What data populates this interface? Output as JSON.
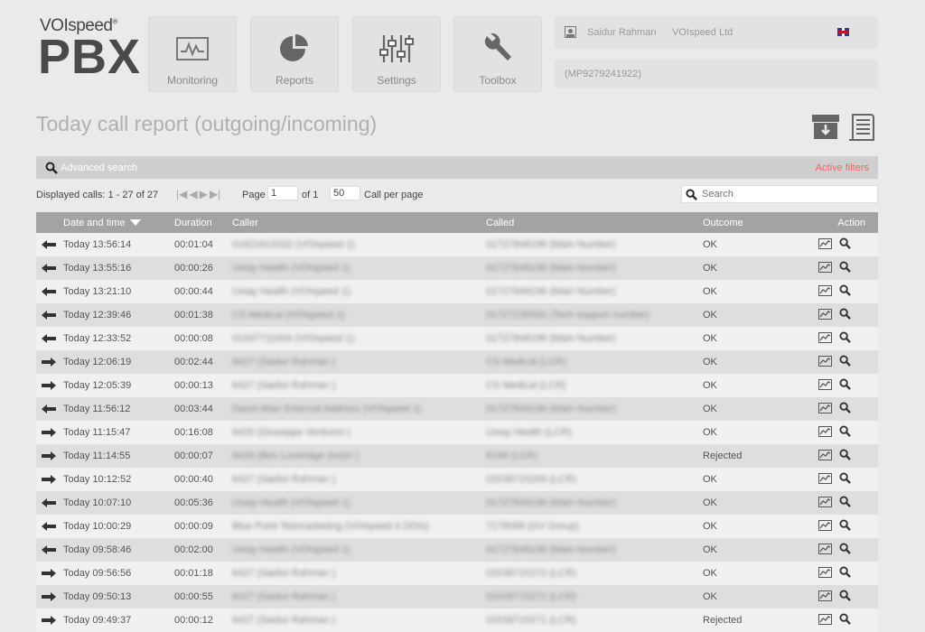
{
  "logo": {
    "brand": "VOIspeed",
    "mark": "®",
    "product": "PBX"
  },
  "nav": [
    {
      "label": "Monitoring",
      "icon": "monitoring-icon"
    },
    {
      "label": "Reports",
      "icon": "pie-chart-icon"
    },
    {
      "label": "Settings",
      "icon": "sliders-icon"
    },
    {
      "label": "Toolbox",
      "icon": "wrench-icon"
    }
  ],
  "user": {
    "name": "Saidur Rahman",
    "company": "VOIspeed Ltd",
    "account": "(MP9279241922)",
    "language_flag": "uk-flag-icon"
  },
  "page_title": "Today call report (outgoing/incoming)",
  "toolbar": {
    "advanced_search": "Advanced search",
    "active_filters": "Active filters"
  },
  "pager": {
    "displayed": "Displayed calls: 1 - 27 of 27",
    "page_label": "Page",
    "page_value": "1",
    "of_label": "of 1",
    "per_page_value": "50",
    "per_page_label": "Call per page",
    "search_placeholder": "Search"
  },
  "table": {
    "headers": {
      "date": "Date and time",
      "duration": "Duration",
      "caller": "Caller",
      "called": "Called",
      "outcome": "Outcome",
      "action": "Action"
    },
    "rows": [
      {
        "dir": "in",
        "date": "Today 13:56:14",
        "duration": "00:01:04",
        "caller": "01621613332 (VOIspeed 1)",
        "called": "01727848196 (Main Number)",
        "outcome": "OK"
      },
      {
        "dir": "in",
        "date": "Today 13:55:16",
        "duration": "00:00:26",
        "caller": "Uway Health (VOIspeed 1)",
        "called": "01727848196 (Main Number)",
        "outcome": "OK"
      },
      {
        "dir": "in",
        "date": "Today 13:21:10",
        "duration": "00:00:44",
        "caller": "Uway Health (VOIspeed 1)",
        "called": "01727848196 (Main Number)",
        "outcome": "OK"
      },
      {
        "dir": "in",
        "date": "Today 12:39:46",
        "duration": "00:01:38",
        "caller": "CS Medical (VOIspeed 1)",
        "called": "01727238592 (Tech support number)",
        "outcome": "OK"
      },
      {
        "dir": "in",
        "date": "Today 12:33:52",
        "duration": "00:00:08",
        "caller": "01937711004 (VOIspeed 1)",
        "called": "01727848196 (Main Number)",
        "outcome": "OK"
      },
      {
        "dir": "out",
        "date": "Today 12:06:19",
        "duration": "00:02:44",
        "caller": "6427 (Saidur Rahman )",
        "called": "CS Medical (LCR)",
        "outcome": "OK"
      },
      {
        "dir": "out",
        "date": "Today 12:05:39",
        "duration": "00:00:13",
        "caller": "6427 (Saidur Rahman )",
        "called": "CS Medical (LCR)",
        "outcome": "OK"
      },
      {
        "dir": "in",
        "date": "Today 11:56:12",
        "duration": "00:03:44",
        "caller": "David Allan External Address (VOIspeed 1)",
        "called": "01727848196 (Main Number)",
        "outcome": "OK"
      },
      {
        "dir": "out",
        "date": "Today 11:15:47",
        "duration": "00:16:08",
        "caller": "6420 (Giuseppe Venturini )",
        "called": "Uway Health (LCR)",
        "outcome": "OK"
      },
      {
        "dir": "out",
        "date": "Today 11:14:55",
        "duration": "00:00:07",
        "caller": "6428 (Ben Loveridge (ext)n )",
        "called": "6248 (LCR)",
        "outcome": "Rejected"
      },
      {
        "dir": "out",
        "date": "Today 10:12:52",
        "duration": "00:00:40",
        "caller": "6427 (Saidur Rahman )",
        "called": "02038715269 (LCR)",
        "outcome": "OK"
      },
      {
        "dir": "in",
        "date": "Today 10:07:10",
        "duration": "00:05:36",
        "caller": "Uway Health (VOIspeed 1)",
        "called": "01727848196 (Main Number)",
        "outcome": "OK"
      },
      {
        "dir": "in",
        "date": "Today 10:00:29",
        "duration": "00:00:09",
        "caller": "Blue Point Telemarketing (VOIspeed 4 DDIs)",
        "called": "7178098 (GV Group)",
        "outcome": "OK"
      },
      {
        "dir": "in",
        "date": "Today 09:58:46",
        "duration": "00:02:00",
        "caller": "Uway Health (VOIspeed 1)",
        "called": "01727848196 (Main Number)",
        "outcome": "OK"
      },
      {
        "dir": "out",
        "date": "Today 09:56:56",
        "duration": "00:01:18",
        "caller": "6427 (Saidur Rahman )",
        "called": "02038715272 (LCR)",
        "outcome": "OK"
      },
      {
        "dir": "out",
        "date": "Today 09:50:13",
        "duration": "00:00:55",
        "caller": "6427 (Saidur Rahman )",
        "called": "02038715272 (LCR)",
        "outcome": "OK"
      },
      {
        "dir": "out",
        "date": "Today 09:49:37",
        "duration": "00:00:12",
        "caller": "6427 (Saidur Rahman )",
        "called": "02038715271 (LCR)",
        "outcome": "Rejected"
      }
    ]
  }
}
